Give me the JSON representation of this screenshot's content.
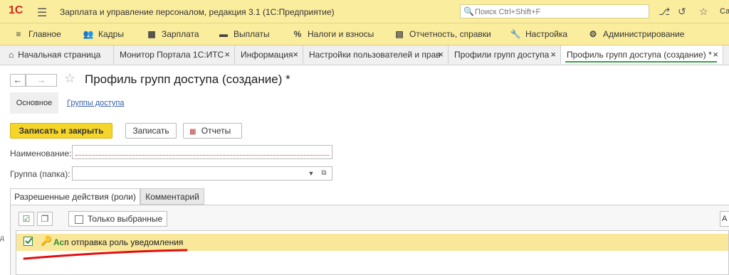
{
  "titlebar": {
    "logo": "1С",
    "title": "Зарплата и управление персоналом, редакция 3.1  (1С:Предприятие)",
    "search_placeholder": "Поиск Ctrl+Shift+F",
    "user_cut": "Сав"
  },
  "menu": [
    {
      "icon": "≡",
      "label": "Главное"
    },
    {
      "icon": "👥",
      "label": "Кадры"
    },
    {
      "icon": "▦",
      "label": "Зарплата"
    },
    {
      "icon": "▬",
      "label": "Выплаты"
    },
    {
      "icon": "%",
      "label": "Налоги и взносы"
    },
    {
      "icon": "▤",
      "label": "Отчетность, справки"
    },
    {
      "icon": "🔧",
      "label": "Настройка"
    },
    {
      "icon": "⚙",
      "label": "Администрирование"
    }
  ],
  "tabs": [
    {
      "label": "Начальная страница"
    },
    {
      "label": "Монитор Портала 1С:ИТС",
      "close": "×"
    },
    {
      "label": "Информация",
      "close": "×"
    },
    {
      "label": "Настройки пользователей и прав",
      "close": "×"
    },
    {
      "label": "Профили групп доступа",
      "close": "×"
    },
    {
      "label": "Профиль групп доступа (создание) *",
      "close": "×"
    }
  ],
  "page": {
    "title": "Профиль групп доступа (создание) *",
    "tab_main": "Основное",
    "tab_link": "Группы доступа",
    "btn_save_close": "Записать и закрыть",
    "btn_save": "Записать",
    "btn_reports": "Отчеты",
    "label_name": "Наименование:",
    "name_value": "",
    "label_group": "Группа (папка):",
    "group_value": "",
    "subtab_roles": "Разрешенные действия (роли)",
    "subtab_comment": "Комментарий",
    "filter_label": "Только выбранные",
    "right_cut": "А"
  },
  "roles": [
    {
      "prefix": "Ас",
      "text": "п отправка роль уведомления",
      "checked": true
    }
  ]
}
